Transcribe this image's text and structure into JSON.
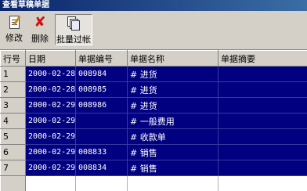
{
  "window": {
    "title": "查看草稿单据"
  },
  "toolbar": {
    "edit_label": "修改",
    "delete_label": "删除",
    "batch_post_label": "批量过帐"
  },
  "table": {
    "columns": [
      "行号",
      "日期",
      "单据编号",
      "单据名称",
      "单据摘要"
    ],
    "rows": [
      {
        "num": "1",
        "date": "2000-02-28",
        "code": "008984",
        "name": "# 进货",
        "summary": ""
      },
      {
        "num": "2",
        "date": "2000-02-28",
        "code": "008985",
        "name": "# 进货",
        "summary": ""
      },
      {
        "num": "3",
        "date": "2000-02-29",
        "code": "008986",
        "name": "# 进货",
        "summary": ""
      },
      {
        "num": "4",
        "date": "2000-02-29",
        "code": "",
        "name": "# 一般费用",
        "summary": ""
      },
      {
        "num": "5",
        "date": "2000-02-29",
        "code": "",
        "name": "# 收款单",
        "summary": ""
      },
      {
        "num": "6",
        "date": "2000-02-29",
        "code": "008833",
        "name": "# 销售",
        "summary": ""
      },
      {
        "num": "7",
        "date": "2000-02-29",
        "code": "008834",
        "name": "# 销售",
        "summary": ""
      }
    ]
  },
  "colors": {
    "selection": "#000080",
    "chrome": "#d4d0c8"
  }
}
